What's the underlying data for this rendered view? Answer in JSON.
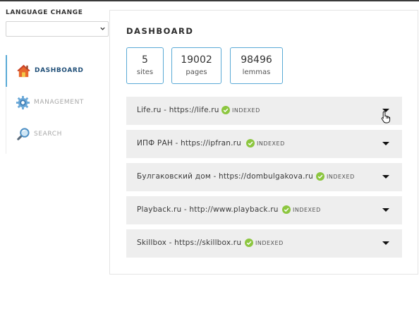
{
  "sidebar": {
    "language_label": "LANGUAGE CHANGE",
    "language_value": "",
    "nav": [
      {
        "label": "DASHBOARD",
        "icon": "home-icon",
        "active": true
      },
      {
        "label": "MANAGEMENT",
        "icon": "gear-icon",
        "active": false
      },
      {
        "label": "SEARCH",
        "icon": "magnifier-icon",
        "active": false
      }
    ]
  },
  "dashboard": {
    "title": "DASHBOARD",
    "stats": [
      {
        "value": "5",
        "caption": "sites"
      },
      {
        "value": "19002",
        "caption": "pages"
      },
      {
        "value": "98496",
        "caption": "lemmas"
      }
    ],
    "sites": [
      {
        "name": "Life.ru - https://life.ru",
        "status": "INDEXED"
      },
      {
        "name": "ИПФ РАН - https://ipfran.ru",
        "status": "INDEXED"
      },
      {
        "name": "Булгаковский дом - https://dombulgakova.ru",
        "status": "INDEXED"
      },
      {
        "name": "Playback.ru - http://www.playback.ru",
        "status": "INDEXED"
      },
      {
        "name": "Skillbox - https://skillbox.ru",
        "status": "INDEXED"
      }
    ]
  },
  "colors": {
    "accent": "#5aaad6",
    "active_nav": "#1f4e77",
    "indexed": "#8cc63f",
    "row_bg": "#eeeeee"
  }
}
